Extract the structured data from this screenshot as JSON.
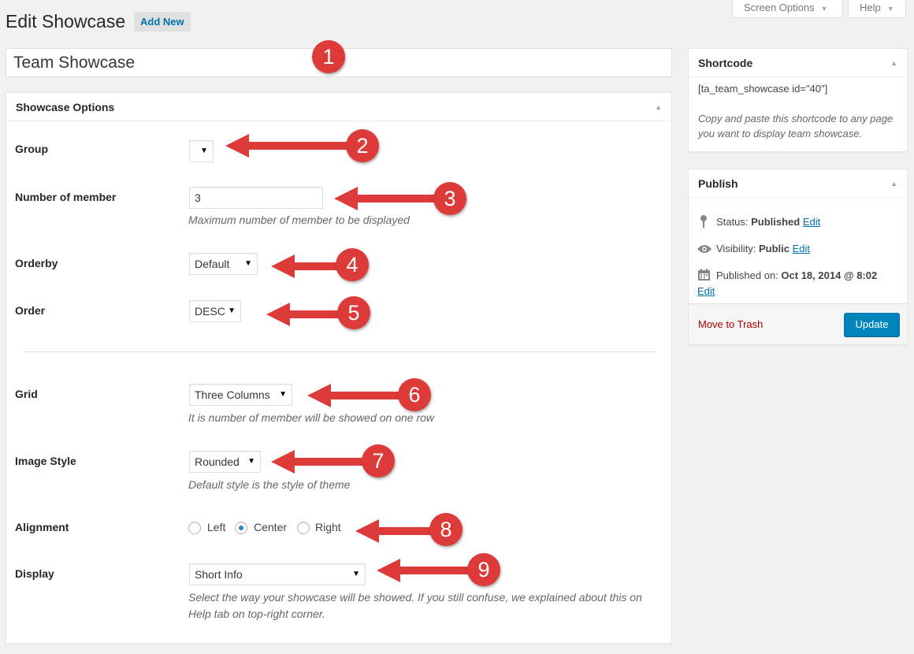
{
  "header": {
    "title": "Edit Showcase",
    "add_new": "Add New",
    "screen_options": "Screen Options",
    "help": "Help"
  },
  "post_title": "Team Showcase",
  "showcase_options": {
    "title": "Showcase Options",
    "group": {
      "label": "Group",
      "value": ""
    },
    "number_of_member": {
      "label": "Number of member",
      "value": "3",
      "desc": "Maximum number of member to be displayed"
    },
    "orderby": {
      "label": "Orderby",
      "value": "Default"
    },
    "order": {
      "label": "Order",
      "value": "DESC"
    },
    "grid": {
      "label": "Grid",
      "value": "Three Columns",
      "desc": "It is number of member will be showed on one row"
    },
    "image_style": {
      "label": "Image Style",
      "value": "Rounded",
      "desc": "Default style is the style of theme"
    },
    "alignment": {
      "label": "Alignment",
      "options": [
        "Left",
        "Center",
        "Right"
      ],
      "selected": "Center"
    },
    "display": {
      "label": "Display",
      "value": "Short Info",
      "desc_line1": "Select the way your showcase will be showed. If you still confuse, we explained about this on",
      "desc_line2": "Help tab on top-right corner."
    }
  },
  "shortcode": {
    "title": "Shortcode",
    "code": "[ta_team_showcase id=\"40\"]",
    "hint_line1": "Copy and paste this shortcode to any page",
    "hint_line2": "you want to display team showcase."
  },
  "publish": {
    "title": "Publish",
    "status_label": "Status:",
    "status_value": "Published",
    "visibility_label": "Visibility:",
    "visibility_value": "Public",
    "published_label": "Published on:",
    "published_value": "Oct 18, 2014 @ 8:02",
    "edit": "Edit",
    "move_to_trash": "Move to Trash",
    "update": "Update"
  },
  "annotations": [
    "1",
    "2",
    "3",
    "4",
    "5",
    "6",
    "7",
    "8",
    "9"
  ],
  "colors": {
    "annotation": "#dd3a3a",
    "link": "#0073aa",
    "primary_button": "#0085ba",
    "trash": "#aa0000"
  },
  "icons": {
    "status": "pin-icon",
    "visibility": "eye-icon",
    "published": "calendar-icon"
  }
}
